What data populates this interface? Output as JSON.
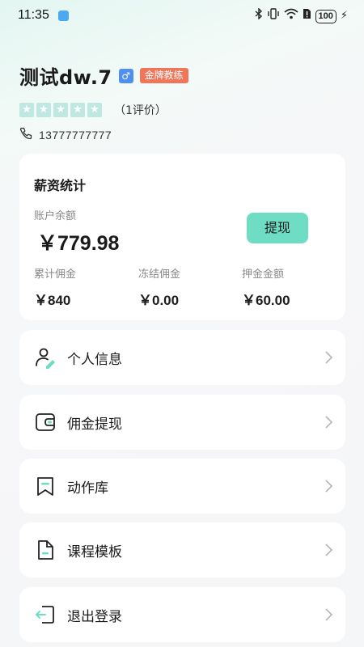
{
  "status_bar": {
    "time": "11:35",
    "battery": "100"
  },
  "profile": {
    "name": "测试dw.7",
    "gender_symbol": "♂",
    "badge": "金牌教练",
    "rating_count": "（1评价）",
    "phone": "13777777777"
  },
  "salary": {
    "title": "薪资统计",
    "balance_label": "账户余额",
    "balance_value": "￥779.98",
    "withdraw_button": "提现",
    "stats": [
      {
        "label": "累计佣金",
        "value": "￥840"
      },
      {
        "label": "冻结佣金",
        "value": "￥0.00"
      },
      {
        "label": "押金金额",
        "value": "￥60.00"
      }
    ]
  },
  "menu": [
    {
      "label": "个人信息",
      "icon": "personal-info-icon"
    },
    {
      "label": "佣金提现",
      "icon": "wallet-icon"
    },
    {
      "label": "动作库",
      "icon": "bookmark-icon"
    },
    {
      "label": "课程模板",
      "icon": "document-icon"
    },
    {
      "label": "退出登录",
      "icon": "logout-icon"
    }
  ],
  "colors": {
    "accent": "#6fdcc4",
    "badge": "#f0765a",
    "gender": "#4f8ff1",
    "star": "#bfe8e2"
  }
}
